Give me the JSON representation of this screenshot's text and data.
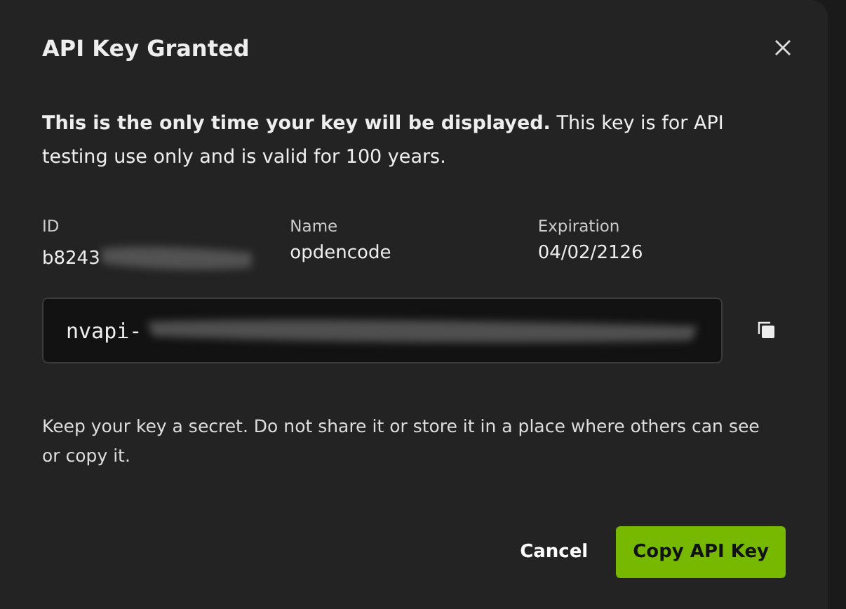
{
  "dialog": {
    "title": "API Key Granted",
    "message": "**This is the only time your key will be displayed.** This key is for API testing use only and is valid for 100 years.",
    "fields": [
      {
        "label": "ID",
        "value": "b8243",
        "redacted": true
      },
      {
        "label": "Name",
        "value": "opdencode",
        "redacted": false
      },
      {
        "label": "Expiration",
        "value": "04/02/2126",
        "redacted": false
      }
    ],
    "key": {
      "value": "nvapi-",
      "redacted": true
    },
    "note": "Keep your key a secret. Do not share it or store it in a place where others can see or copy it.",
    "buttons": [
      {
        "label": "Cancel",
        "kind": "secondary"
      },
      {
        "label": "Copy API Key",
        "kind": "primary"
      }
    ]
  }
}
